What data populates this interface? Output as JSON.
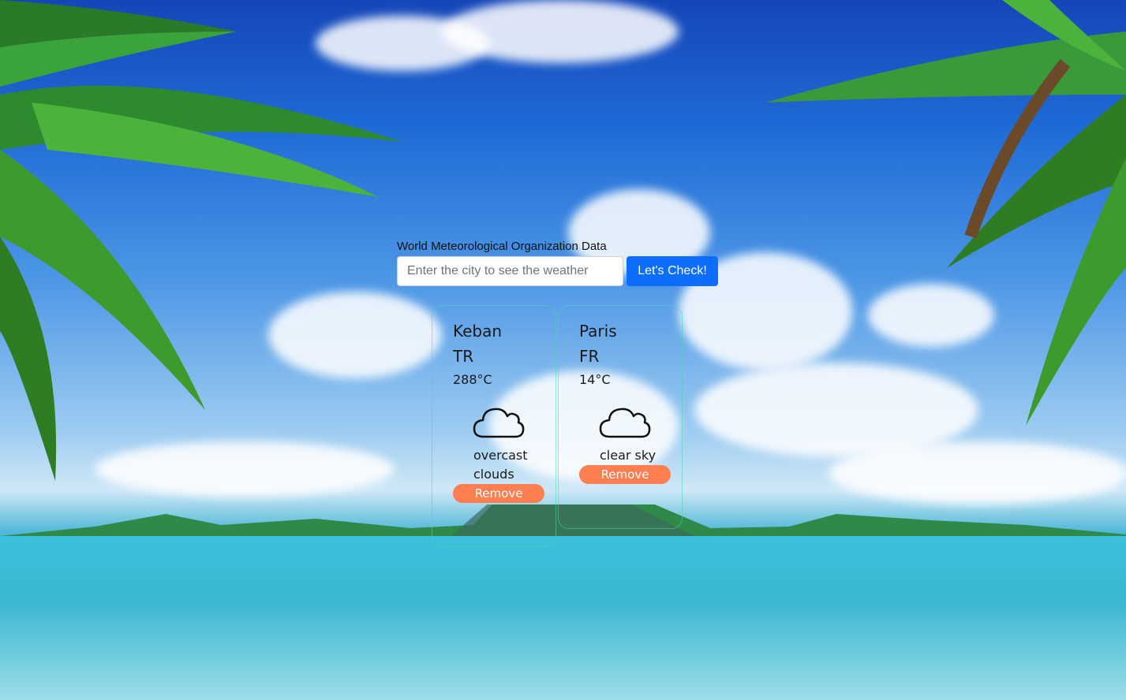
{
  "header": {
    "title": "World Meteorological Organization Data"
  },
  "search": {
    "placeholder": "Enter the city to see the weather",
    "value": "",
    "button_label": "Let's Check!"
  },
  "cards": [
    {
      "city": "Keban",
      "country": "TR",
      "temperature": "288°C",
      "icon": "cloud-icon",
      "description": "overcast clouds",
      "remove_label": "Remove"
    },
    {
      "city": "Paris",
      "country": "FR",
      "temperature": "14°C",
      "icon": "cloud-icon",
      "description": "clear sky",
      "remove_label": "Remove"
    }
  ],
  "colors": {
    "primary_button": "#0d6efd",
    "remove_button": "#ff7f50",
    "card_border": "#40dcaa"
  }
}
